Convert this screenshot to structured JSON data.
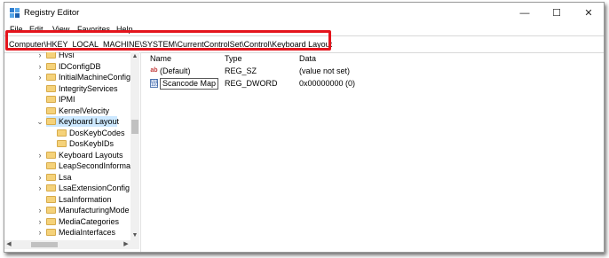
{
  "window": {
    "title": "Registry Editor",
    "icon": "registry-icon",
    "controls": {
      "minimize": "—",
      "maximize": "☐",
      "close": "✕"
    }
  },
  "menu": [
    "File",
    "Edit",
    "View",
    "Favorites",
    "Help"
  ],
  "address": {
    "path": "Computer\\HKEY_LOCAL_MACHINE\\SYSTEM\\CurrentControlSet\\Control\\Keyboard Layout"
  },
  "highlight_color": "#e4141c",
  "tree": {
    "items": [
      {
        "label": "Hvsi",
        "expander": "›"
      },
      {
        "label": "IDConfigDB",
        "expander": "›"
      },
      {
        "label": "InitialMachineConfig",
        "expander": "›"
      },
      {
        "label": "IntegrityServices",
        "expander": ""
      },
      {
        "label": "IPMI",
        "expander": ""
      },
      {
        "label": "KernelVelocity",
        "expander": ""
      },
      {
        "label": "Keyboard Layout",
        "expander": "⌄",
        "selected": true
      },
      {
        "label": "DosKeybCodes",
        "expander": "",
        "child": true
      },
      {
        "label": "DosKeybIDs",
        "expander": "",
        "child": true
      },
      {
        "label": "Keyboard Layouts",
        "expander": "›"
      },
      {
        "label": "LeapSecondInformation",
        "expander": ""
      },
      {
        "label": "Lsa",
        "expander": "›"
      },
      {
        "label": "LsaExtensionConfig",
        "expander": "›"
      },
      {
        "label": "LsaInformation",
        "expander": ""
      },
      {
        "label": "ManufacturingMode",
        "expander": "›"
      },
      {
        "label": "MediaCategories",
        "expander": "›"
      },
      {
        "label": "MediaInterfaces",
        "expander": "›"
      }
    ]
  },
  "list": {
    "columns": {
      "name": "Name",
      "type": "Type",
      "data": "Data"
    },
    "values": [
      {
        "icon": "string-value-icon",
        "icon_text": "ab",
        "name": "(Default)",
        "type": "REG_SZ",
        "data": "(value not set)"
      },
      {
        "icon": "binary-value-icon",
        "icon_text": "011 110",
        "name": "Scancode Map",
        "type": "REG_DWORD",
        "data": "0x00000000 (0)",
        "editing": true
      }
    ]
  }
}
